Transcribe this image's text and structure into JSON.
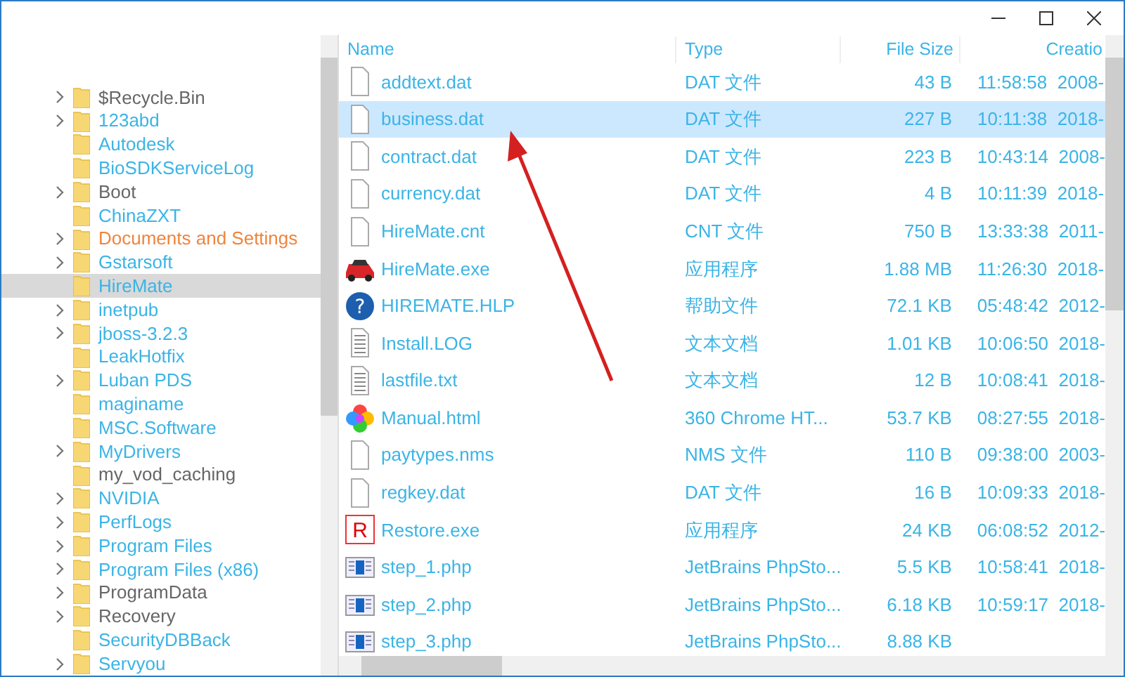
{
  "tree": {
    "items": [
      {
        "label": "$Recycle.Bin",
        "expandable": true,
        "selected": false,
        "color": "#666666"
      },
      {
        "label": "123abd",
        "expandable": true,
        "selected": false,
        "color": "#3bb4e6"
      },
      {
        "label": "Autodesk",
        "expandable": false,
        "selected": false,
        "color": "#3bb4e6"
      },
      {
        "label": "BioSDKServiceLog",
        "expandable": false,
        "selected": false,
        "color": "#3bb4e6"
      },
      {
        "label": "Boot",
        "expandable": true,
        "selected": false,
        "color": "#666666"
      },
      {
        "label": "ChinaZXT",
        "expandable": false,
        "selected": false,
        "color": "#3bb4e6"
      },
      {
        "label": "Documents and Settings",
        "expandable": true,
        "selected": false,
        "color": "#f0843c"
      },
      {
        "label": "Gstarsoft",
        "expandable": true,
        "selected": false,
        "color": "#3bb4e6"
      },
      {
        "label": "HireMate",
        "expandable": false,
        "selected": true,
        "color": "#3bb4e6"
      },
      {
        "label": "inetpub",
        "expandable": true,
        "selected": false,
        "color": "#3bb4e6"
      },
      {
        "label": "jboss-3.2.3",
        "expandable": true,
        "selected": false,
        "color": "#3bb4e6"
      },
      {
        "label": "LeakHotfix",
        "expandable": false,
        "selected": false,
        "color": "#3bb4e6"
      },
      {
        "label": "Luban PDS",
        "expandable": true,
        "selected": false,
        "color": "#3bb4e6"
      },
      {
        "label": "maginame",
        "expandable": false,
        "selected": false,
        "color": "#3bb4e6"
      },
      {
        "label": "MSC.Software",
        "expandable": false,
        "selected": false,
        "color": "#3bb4e6"
      },
      {
        "label": "MyDrivers",
        "expandable": true,
        "selected": false,
        "color": "#3bb4e6"
      },
      {
        "label": "my_vod_caching",
        "expandable": false,
        "selected": false,
        "color": "#666666"
      },
      {
        "label": "NVIDIA",
        "expandable": true,
        "selected": false,
        "color": "#3bb4e6"
      },
      {
        "label": "PerfLogs",
        "expandable": true,
        "selected": false,
        "color": "#3bb4e6"
      },
      {
        "label": "Program Files",
        "expandable": true,
        "selected": false,
        "color": "#3bb4e6"
      },
      {
        "label": "Program Files (x86)",
        "expandable": true,
        "selected": false,
        "color": "#3bb4e6"
      },
      {
        "label": "ProgramData",
        "expandable": true,
        "selected": false,
        "color": "#666666"
      },
      {
        "label": "Recovery",
        "expandable": true,
        "selected": false,
        "color": "#666666"
      },
      {
        "label": "SecurityDBBack",
        "expandable": false,
        "selected": false,
        "color": "#3bb4e6"
      },
      {
        "label": "Servyou",
        "expandable": true,
        "selected": false,
        "color": "#3bb4e6"
      }
    ]
  },
  "table": {
    "columns": [
      "Name",
      "Type",
      "File Size",
      "Creatio"
    ],
    "rows": [
      {
        "kind": "file",
        "name": "addtext.dat",
        "type": "DAT 文件",
        "size": "43 B",
        "created": "11:58:58  2008-",
        "selected": false
      },
      {
        "kind": "file",
        "name": "business.dat",
        "type": "DAT 文件",
        "size": "227 B",
        "created": "10:11:38  2018-",
        "selected": true
      },
      {
        "kind": "file",
        "name": "contract.dat",
        "type": "DAT 文件",
        "size": "223 B",
        "created": "10:43:14  2008-",
        "selected": false
      },
      {
        "kind": "file",
        "name": "currency.dat",
        "type": "DAT 文件",
        "size": "4 B",
        "created": "10:11:39  2018-",
        "selected": false
      },
      {
        "kind": "file",
        "name": "HireMate.cnt",
        "type": "CNT 文件",
        "size": "750 B",
        "created": "13:33:38  2011-",
        "selected": false
      },
      {
        "kind": "car",
        "name": "HireMate.exe",
        "type": "应用程序",
        "size": "1.88 MB",
        "created": "11:26:30  2018-",
        "selected": false
      },
      {
        "kind": "help",
        "icon_text": "?",
        "name": "HIREMATE.HLP",
        "type": "帮助文件",
        "size": "72.1 KB",
        "created": "05:48:42  2012-",
        "selected": false
      },
      {
        "kind": "text",
        "name": "Install.LOG",
        "type": "文本文档",
        "size": "1.01 KB",
        "created": "10:06:50  2018-",
        "selected": false
      },
      {
        "kind": "text",
        "name": "lastfile.txt",
        "type": "文本文档",
        "size": "12 B",
        "created": "10:08:41  2018-",
        "selected": false
      },
      {
        "kind": "browser",
        "name": "Manual.html",
        "type": "360 Chrome HT...",
        "size": "53.7 KB",
        "created": "08:27:55  2018-",
        "selected": false
      },
      {
        "kind": "file",
        "name": "paytypes.nms",
        "type": "NMS 文件",
        "size": "110 B",
        "created": "09:38:00  2003-",
        "selected": false
      },
      {
        "kind": "file",
        "name": "regkey.dat",
        "type": "DAT 文件",
        "size": "16 B",
        "created": "10:09:33  2018-",
        "selected": false
      },
      {
        "kind": "restore",
        "icon_text": "R",
        "name": "Restore.exe",
        "type": "应用程序",
        "size": "24 KB",
        "created": "06:08:52  2012-",
        "selected": false
      },
      {
        "kind": "php",
        "name": "step_1.php",
        "type": "JetBrains PhpSto...",
        "size": "5.5 KB",
        "created": "10:58:41  2018-",
        "selected": false
      },
      {
        "kind": "php",
        "name": "step_2.php",
        "type": "JetBrains PhpSto...",
        "size": "6.18 KB",
        "created": "10:59:17  2018-",
        "selected": false
      },
      {
        "kind": "php",
        "name": "step_3.php",
        "type": "JetBrains PhpSto...",
        "size": "8.88 KB",
        "selected": false
      }
    ]
  }
}
